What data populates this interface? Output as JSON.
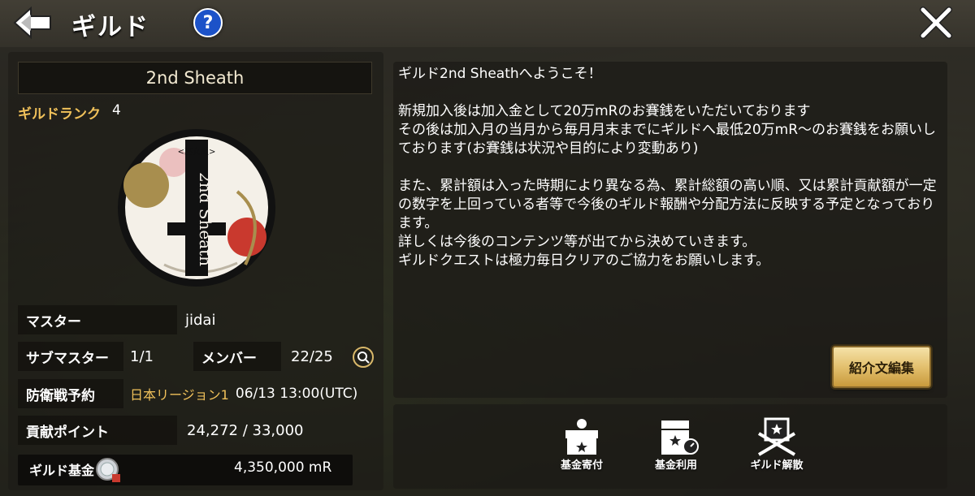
{
  "header": {
    "title": "ギルド",
    "help_label": "?"
  },
  "guild": {
    "name": "2nd Sheath",
    "rank_label": "ギルドランク",
    "rank_value": "4"
  },
  "info": {
    "master_label": "マスター",
    "master_value": "jidai",
    "submaster_label": "サブマスター",
    "submaster_value": "1/1",
    "member_label": "メンバー",
    "member_value": "22/25",
    "defense_label": "防衛戦予約",
    "defense_region": "日本リージョン1",
    "defense_time": "06/13 13:00(UTC)",
    "contrib_label": "貢献ポイント",
    "contrib_value": "24,272 / 33,000",
    "fund_label": "ギルド基金",
    "fund_value": "4,350,000 mR"
  },
  "description": {
    "text": "ギルド2nd Sheathへようこそ！\n\n新規加入後は加入金として20万mRのお賽銭をいただいております\nその後は加入月の当月から毎月月末までにギルドへ最低20万mR～のお賽銭をお願いしております(お賽銭は状況や目的により変動あり)\n\nまた、累計額は入った時期により異なる為、累計総額の高い順、又は累計貢献額が一定の数字を上回っている者等で今後のギルド報酬や分配方法に反映する予定となっております。\n詳しくは今後のコンテンツ等が出てから決めていきます。\nギルドクエストは極力毎日クリアのご協力をお願いします。",
    "edit_button": "紹介文編集"
  },
  "actions": {
    "donate_label": "基金寄付",
    "use_label": "基金利用",
    "disband_label": "ギルド解散"
  },
  "colors": {
    "accent_gold": "#f0c15a",
    "button_gold": "#e3c06e",
    "help_blue": "#1c52c8"
  }
}
